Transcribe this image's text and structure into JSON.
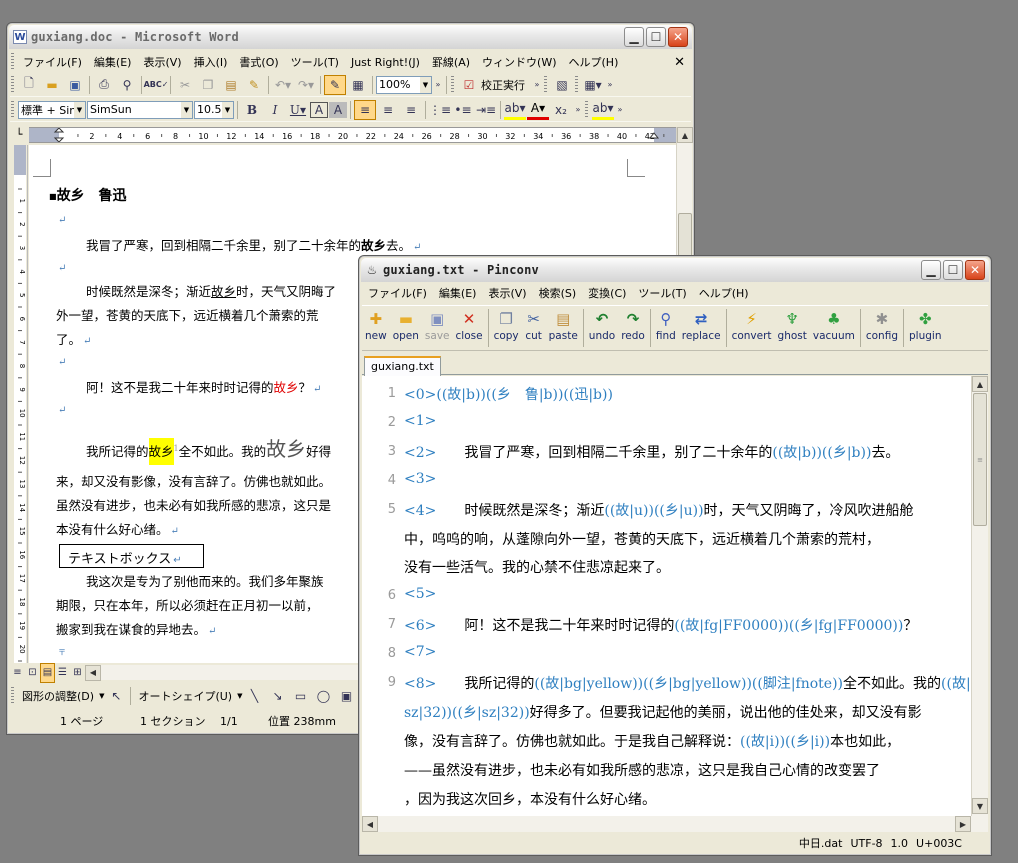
{
  "word": {
    "title": "guxiang.doc - Microsoft Word",
    "menu": [
      "ファイル(F)",
      "編集(E)",
      "表示(V)",
      "挿入(I)",
      "書式(O)",
      "ツール(T)",
      "Just Right!(J)",
      "罫線(A)",
      "ウィンドウ(W)",
      "ヘルプ(H)"
    ],
    "zoom": "100%",
    "spell_check": "校正実行",
    "style": "標準 + Sin",
    "font": "SimSun",
    "size": "10.5",
    "ruler_ticks": [
      "2",
      "4",
      "6",
      "8",
      "10",
      "12",
      "14",
      "16",
      "18",
      "20",
      "22",
      "24",
      "26",
      "28",
      "30",
      "32",
      "34",
      "36",
      "38",
      "40",
      "42"
    ],
    "vruler_ticks": [
      "1",
      "2",
      "3",
      "4",
      "5",
      "6",
      "7",
      "8",
      "9",
      "10",
      "11",
      "12",
      "13",
      "14",
      "15",
      "16",
      "17",
      "18",
      "19",
      "20",
      "21"
    ],
    "doc": {
      "title": "故乡　鲁迅",
      "p1a": "我冒了严寒，回到相隔二千余里，别了二十余年的",
      "p1b": "故乡",
      "p1c": "去。",
      "p2a": "时候既然是深冬；渐近",
      "p2b": "故乡",
      "p2c": "时，天气又阴晦了",
      "p2d": "外一望，苍黄的天底下，远近横着几个萧索的荒",
      "p2e": "了。",
      "p3a": "阿！这不是我二十年来时时记得的",
      "p3b": "故乡",
      "p3c": "？",
      "p4a": "我所记得的",
      "p4b": "故乡",
      "p4c": "全不如此。我的",
      "p4d": "故乡",
      "p4e": "好得",
      "p4f": "来，却又没有影像，没有言辞了。仿佛也就如此。",
      "p4g": "虽然没有进步，也未必有如我所感的悲凉，这只是",
      "p4h": "本没有什么好心绪。",
      "textbox": "テキストボックス",
      "p5a": "我这次是专为了别他而来的。我们多年聚族",
      "p5b": "期限，只在本年，所以必须赶在正月初一以前，",
      "p5c": "搬家到我在谋食的异地去。"
    },
    "drawing_toolbar": [
      "図形の調整(D)",
      "オートシェイプ(U)"
    ],
    "status": [
      "1 ページ",
      "1 セクション",
      "1/1",
      "位置 238mm"
    ]
  },
  "pinconv": {
    "title": "guxiang.txt - Pinconv",
    "menu": [
      "ファイル(F)",
      "編集(E)",
      "表示(V)",
      "検索(S)",
      "変換(C)",
      "ツール(T)",
      "ヘルプ(H)"
    ],
    "toolbar": [
      {
        "label": "new",
        "icon": "new-icon",
        "glyph": "✚",
        "color": "#e0a020",
        "enabled": true
      },
      {
        "label": "open",
        "icon": "open-icon",
        "glyph": "▬",
        "color": "#e8b030",
        "enabled": true
      },
      {
        "label": "save",
        "icon": "save-icon",
        "glyph": "▣",
        "color": "#8090c0",
        "enabled": false
      },
      {
        "label": "close",
        "icon": "close-icon",
        "glyph": "✕",
        "color": "#d03020",
        "enabled": true
      },
      {
        "label": "copy",
        "icon": "copy-icon",
        "glyph": "❐",
        "color": "#7080a0",
        "enabled": true
      },
      {
        "label": "cut",
        "icon": "cut-icon",
        "glyph": "✂",
        "color": "#4060a0",
        "enabled": true
      },
      {
        "label": "paste",
        "icon": "paste-icon",
        "glyph": "▤",
        "color": "#c09040",
        "enabled": true
      },
      {
        "label": "undo",
        "icon": "undo-icon",
        "glyph": "↶",
        "color": "#208030",
        "enabled": true
      },
      {
        "label": "redo",
        "icon": "redo-icon",
        "glyph": "↷",
        "color": "#208030",
        "enabled": true
      },
      {
        "label": "find",
        "icon": "find-icon",
        "glyph": "⚲",
        "color": "#4060c0",
        "enabled": true
      },
      {
        "label": "replace",
        "icon": "replace-icon",
        "glyph": "⇄",
        "color": "#3060c0",
        "enabled": true
      },
      {
        "label": "convert",
        "icon": "convert-icon",
        "glyph": "⚡",
        "color": "#e0a000",
        "enabled": true
      },
      {
        "label": "ghost",
        "icon": "ghost-icon",
        "glyph": "♆",
        "color": "#30a040",
        "enabled": true
      },
      {
        "label": "vacuum",
        "icon": "vacuum-icon",
        "glyph": "♣",
        "color": "#30a040",
        "enabled": true
      },
      {
        "label": "config",
        "icon": "config-icon",
        "glyph": "✱",
        "color": "#909090",
        "enabled": true
      },
      {
        "label": "plugin",
        "icon": "plugin-icon",
        "glyph": "✤",
        "color": "#30a040",
        "enabled": true
      }
    ],
    "tab": "guxiang.txt",
    "lines": [
      {
        "n": "1",
        "segs": [
          {
            "t": "<0>((故|b))((乡　鲁|b))((迅|b))",
            "c": "tag"
          }
        ]
      },
      {
        "n": "2",
        "segs": [
          {
            "t": "<1>",
            "c": "tag"
          }
        ]
      },
      {
        "n": "3",
        "segs": [
          {
            "t": "<2>",
            "c": "tag"
          },
          {
            "t": "　　我冒了严寒，回到相隔二千余里，别了二十余年的",
            "c": ""
          },
          {
            "t": "((故|b))((乡|b))",
            "c": "tag"
          },
          {
            "t": "去。",
            "c": ""
          }
        ]
      },
      {
        "n": "4",
        "segs": [
          {
            "t": "<3>",
            "c": "tag"
          }
        ]
      },
      {
        "n": "5",
        "segs": [
          {
            "t": "<4>",
            "c": "tag"
          },
          {
            "t": "　　时候既然是深冬；渐近",
            "c": ""
          },
          {
            "t": "((故|u))((乡|u))",
            "c": "tag"
          },
          {
            "t": "时，天气又阴晦了，冷风吹进船舱",
            "c": ""
          }
        ]
      },
      {
        "n": "",
        "segs": [
          {
            "t": "中，呜呜的响，从蓬隙向外一望，苍黄的天底下，远近横着几个萧索的荒村，",
            "c": ""
          }
        ]
      },
      {
        "n": "",
        "segs": [
          {
            "t": "没有一些活气。我的心禁不住悲凉起来了。",
            "c": ""
          }
        ]
      },
      {
        "n": "6",
        "segs": [
          {
            "t": "<5>",
            "c": "tag"
          }
        ]
      },
      {
        "n": "7",
        "segs": [
          {
            "t": "<6>",
            "c": "tag"
          },
          {
            "t": "　　阿！这不是我二十年来时时记得的",
            "c": ""
          },
          {
            "t": "((故|fg|FF0000))((乡|fg|FF0000))",
            "c": "tag"
          },
          {
            "t": "？",
            "c": ""
          }
        ]
      },
      {
        "n": "8",
        "segs": [
          {
            "t": "<7>",
            "c": "tag"
          }
        ]
      },
      {
        "n": "9",
        "segs": [
          {
            "t": "<8>",
            "c": "tag"
          },
          {
            "t": "　　我所记得的",
            "c": ""
          },
          {
            "t": "((故|bg|yellow))((乡|bg|yellow))((脚注|fnote))",
            "c": "tag"
          },
          {
            "t": "全不如此。我的",
            "c": ""
          },
          {
            "t": "((故|",
            "c": "tag"
          }
        ]
      },
      {
        "n": "",
        "segs": [
          {
            "t": "sz|32))((乡|sz|32))",
            "c": "tag"
          },
          {
            "t": "好得多了。但要我记起他的美丽，说出他的佳处来，却又没有影",
            "c": ""
          }
        ]
      },
      {
        "n": "",
        "segs": [
          {
            "t": "像，没有言辞了。仿佛也就如此。于是我自己解释说：",
            "c": ""
          },
          {
            "t": "((故|i))((乡|i))",
            "c": "tag"
          },
          {
            "t": "本也如此，",
            "c": ""
          }
        ]
      },
      {
        "n": "",
        "segs": [
          {
            "t": "——虽然没有进步，也未必有如我所感的悲凉，这只是我自己心情的改变罢了",
            "c": ""
          }
        ]
      },
      {
        "n": "",
        "segs": [
          {
            "t": "，因为我这次回乡，本没有什么好心绪。",
            "c": ""
          }
        ]
      }
    ],
    "status": [
      "中日.dat",
      "UTF-8",
      "1.0",
      "U+003C"
    ]
  }
}
